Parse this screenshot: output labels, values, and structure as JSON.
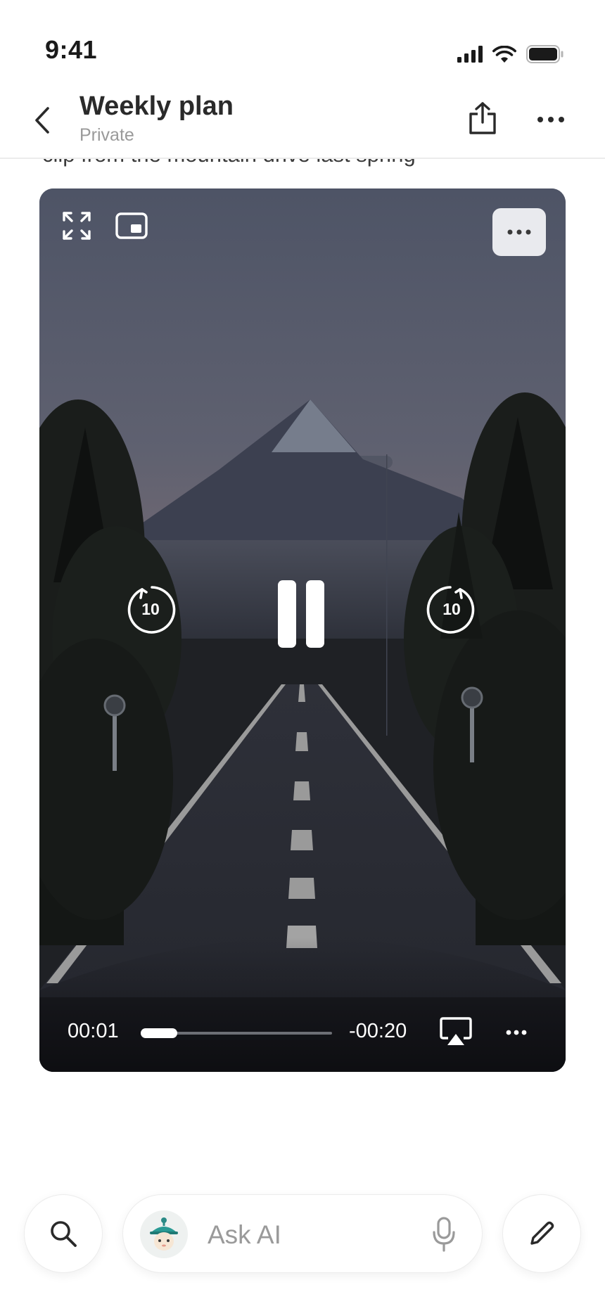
{
  "status_bar": {
    "time": "9:41",
    "icons": [
      "cellular-signal-icon",
      "wifi-icon",
      "battery-icon"
    ]
  },
  "header": {
    "title": "Weekly plan",
    "subtitle": "Private",
    "icons": [
      "back-chevron-icon",
      "share-icon",
      "more-horizontal-icon"
    ]
  },
  "caption": "clip from the mountain drive last spring",
  "video": {
    "scene": "mountain road at dusk",
    "rewind_label": "10",
    "forward_label": "10",
    "elapsed": "00:01",
    "remaining": "-00:20",
    "progress_fraction": 0.19,
    "state": "playing",
    "icons": [
      "fullscreen-icon",
      "picture-in-picture-icon",
      "more-icon",
      "rewind-10-icon",
      "pause-icon",
      "forward-10-icon",
      "airplay-icon",
      "more-icon"
    ]
  },
  "bottom_bar": {
    "ask_placeholder": "Ask AI",
    "icons": [
      "search-icon",
      "ai-assistant-avatar",
      "microphone-icon",
      "edit-pencil-icon"
    ]
  },
  "colors": {
    "text_primary": "#2a2a2a",
    "text_secondary": "#9a9a9a",
    "video_control_bg": "#e9eaee"
  }
}
